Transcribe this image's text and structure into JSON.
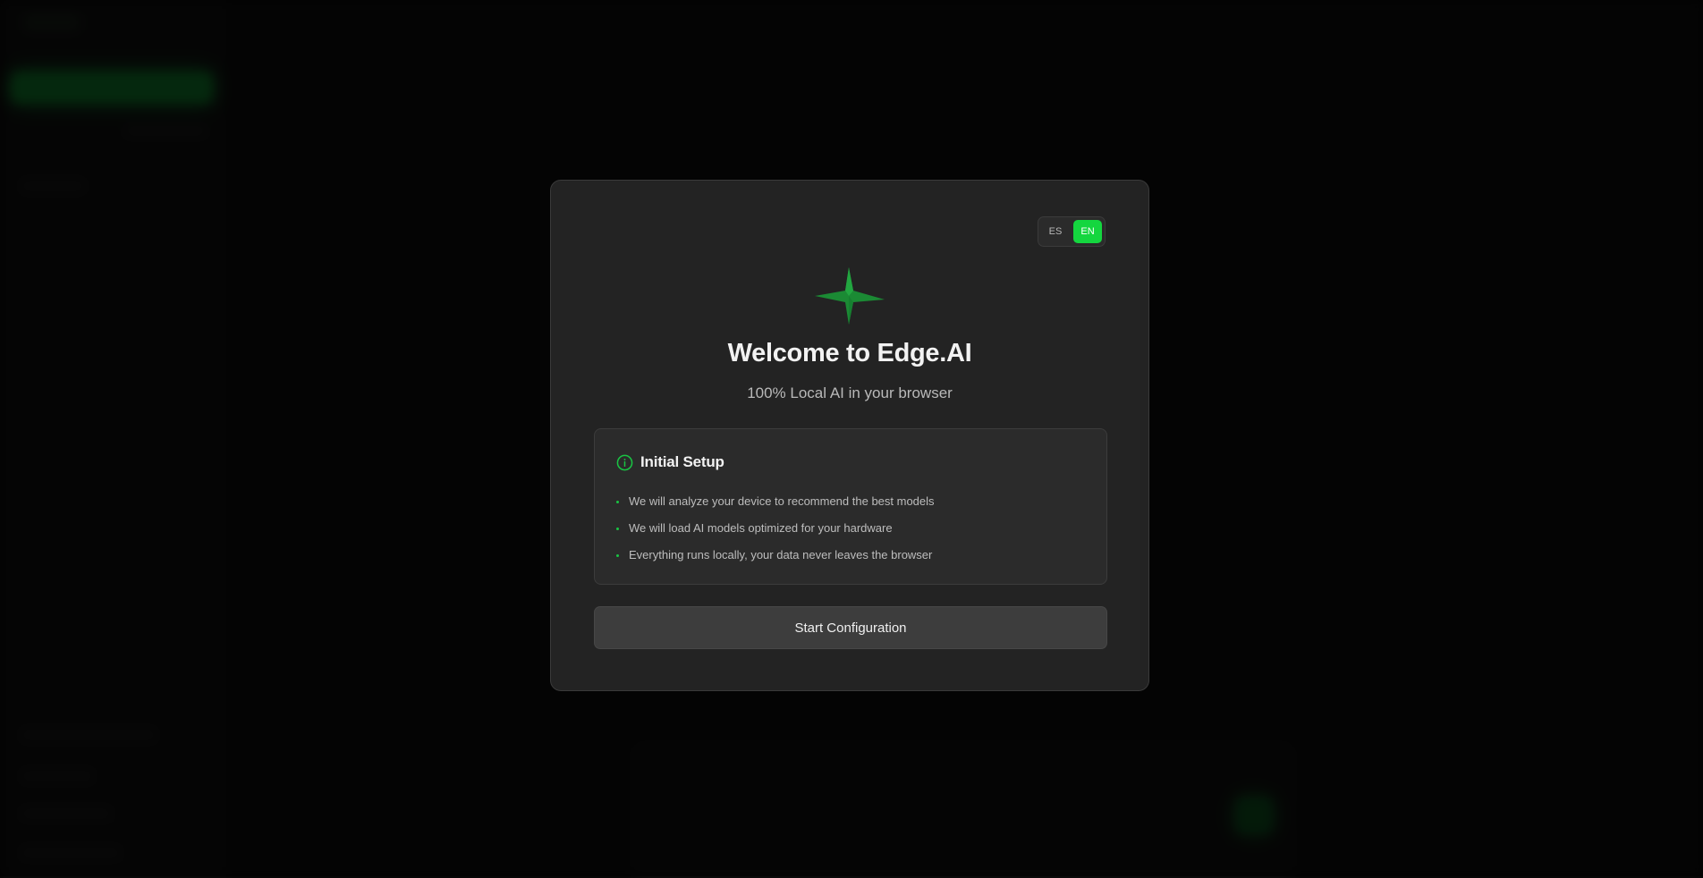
{
  "language_toggle": {
    "options": [
      {
        "label": "ES",
        "active": false
      },
      {
        "label": "EN",
        "active": true
      }
    ]
  },
  "welcome": {
    "logo_icon": "sparkle-star-icon",
    "title": "Welcome to Edge.AI",
    "subtitle": "100% Local AI in your browser"
  },
  "setup": {
    "icon": "info-circle-icon",
    "title": "Initial Setup",
    "items": [
      "We will analyze your device to recommend the best models",
      "We will load AI models optimized for your hardware",
      "Everything runs locally, your data never leaves the browser"
    ]
  },
  "actions": {
    "start_label": "Start Configuration"
  },
  "colors": {
    "accent": "#14d63f",
    "modal_bg": "#232323",
    "page_bg": "#050505"
  }
}
